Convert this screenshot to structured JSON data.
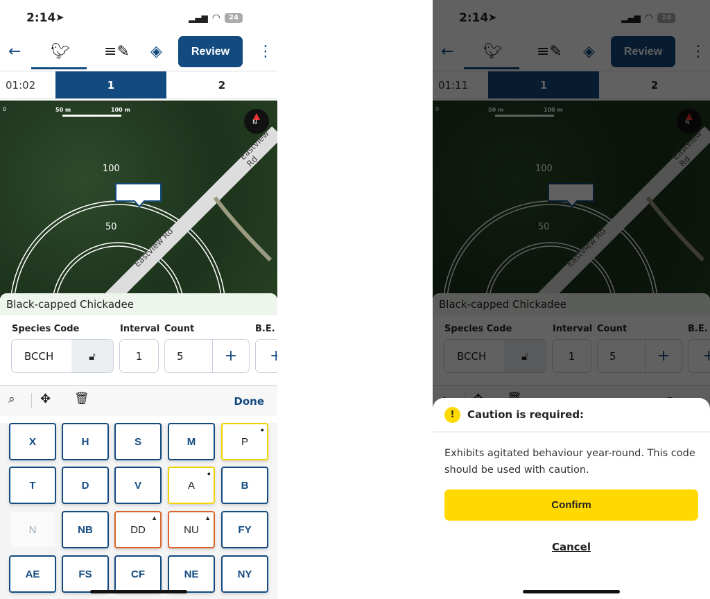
{
  "left": {
    "status": {
      "time": "2:14",
      "battery": "24"
    },
    "review_label": "Review",
    "timer": "01:02",
    "tabs": [
      "1",
      "2"
    ],
    "active_tab": 0
  },
  "right": {
    "status": {
      "time": "2:14",
      "battery": "24"
    },
    "review_label": "Review",
    "timer": "01:11",
    "tabs": [
      "1",
      "2"
    ],
    "active_tab": 0
  },
  "map": {
    "scale": [
      "0",
      "50 m",
      "100 m"
    ],
    "rings": [
      "100",
      "50"
    ],
    "road": "Eastview Rd",
    "compass": "N"
  },
  "species_name": "Black-capped Chickadee",
  "fields": {
    "species_code_label": "Species Code",
    "species_code": "BCCH",
    "interval_label": "Interval",
    "interval": "1",
    "count_label": "Count",
    "count": "5",
    "be_label": "B.E."
  },
  "done_label": "Done",
  "keys": [
    [
      {
        "c": "X"
      },
      {
        "c": "H"
      },
      {
        "c": "S"
      },
      {
        "c": "M"
      },
      {
        "c": "P",
        "s": "caution"
      }
    ],
    [
      {
        "c": "T"
      },
      {
        "c": "D"
      },
      {
        "c": "V"
      },
      {
        "c": "A",
        "s": "caution"
      },
      {
        "c": "B"
      }
    ],
    [
      {
        "c": "N",
        "s": "disabled"
      },
      {
        "c": "NB"
      },
      {
        "c": "DD",
        "s": "warn"
      },
      {
        "c": "NU",
        "s": "warn"
      },
      {
        "c": "FY"
      }
    ],
    [
      {
        "c": "AE"
      },
      {
        "c": "FS"
      },
      {
        "c": "CF"
      },
      {
        "c": "NE"
      },
      {
        "c": "NY"
      }
    ]
  ],
  "modal": {
    "title": "Caution is required:",
    "message": "Exhibits agitated behaviour year-round. This code should be used with caution.",
    "confirm": "Confirm",
    "cancel": "Cancel"
  },
  "colors": {
    "primary": "#134b80",
    "caution": "#ffd900",
    "warning": "#d8662a"
  }
}
